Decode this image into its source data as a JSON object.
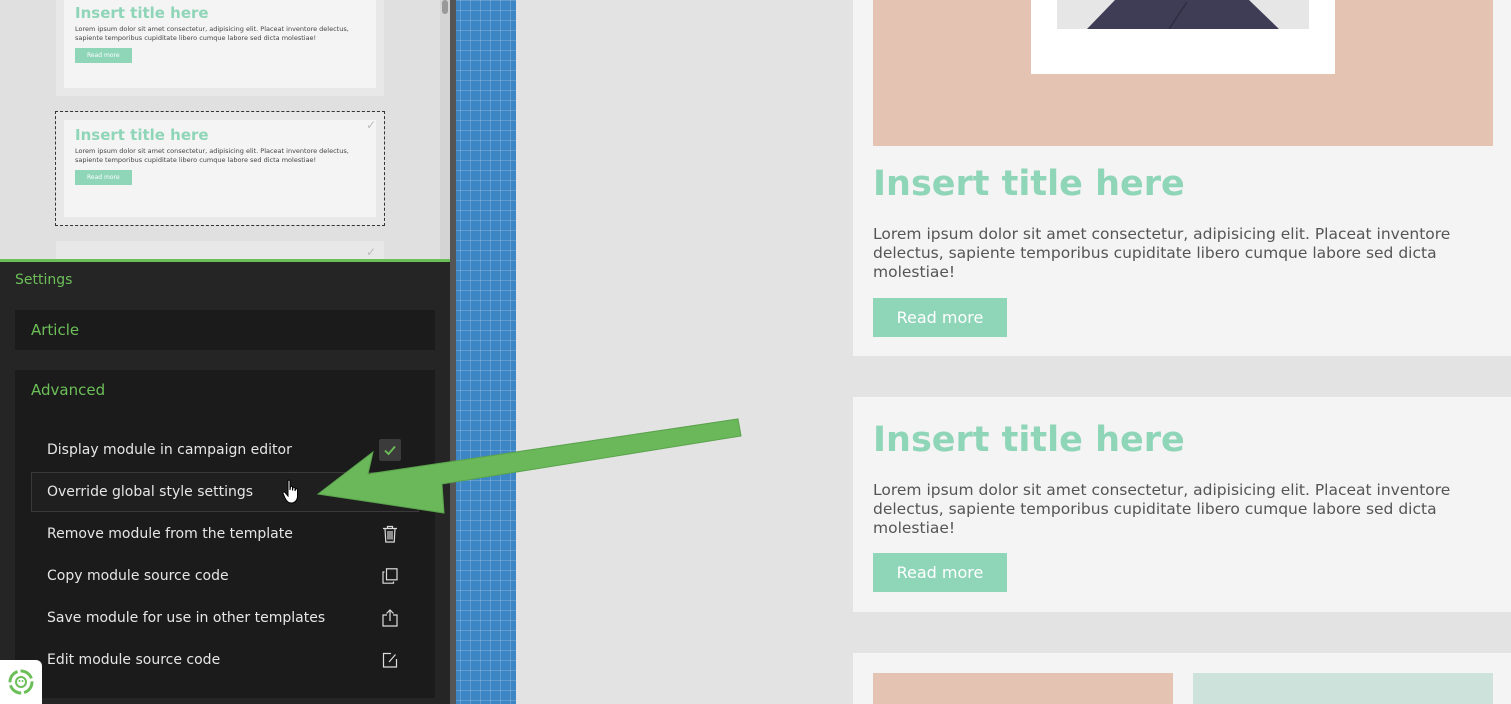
{
  "module_list": {
    "thumbnails": [
      {
        "title": "Insert title here",
        "body": "Lorem ipsum dolor sit amet consectetur, adipisicing elit. Placeat inventore delectus, sapiente temporibus cupiditate libero cumque labore sed dicta molestiae!",
        "button": "Read more"
      },
      {
        "title": "Insert title here",
        "body": "Lorem ipsum dolor sit amet consectetur, adipisicing elit. Placeat inventore delectus, sapiente temporibus cupiditate libero cumque labore sed dicta molestiae!",
        "button": "Read more"
      }
    ]
  },
  "settings": {
    "title": "Settings",
    "sections": {
      "article": "Article",
      "advanced": "Advanced"
    },
    "options": [
      {
        "label": "Display module in campaign editor",
        "icon": "checkbox-checked-icon"
      },
      {
        "label": "Override global style settings",
        "icon": "none"
      },
      {
        "label": "Remove module from the template",
        "icon": "trash-icon"
      },
      {
        "label": "Copy module source code",
        "icon": "copy-icon"
      },
      {
        "label": "Save module for use in other templates",
        "icon": "share-icon"
      },
      {
        "label": "Edit module source code",
        "icon": "edit-icon"
      }
    ]
  },
  "canvas": {
    "cards": [
      {
        "title": "Insert title here",
        "body": "Lorem ipsum dolor sit amet consectetur, adipisicing elit. Placeat inventore delectus, sapiente temporibus cupiditate libero cumque labore sed dicta molestiae!",
        "button": "Read more"
      },
      {
        "title": "Insert title here",
        "body": "Lorem ipsum dolor sit amet consectetur, adipisicing elit. Placeat inventore delectus, sapiente temporibus cupiditate libero cumque labore sed dicta molestiae!",
        "button": "Read more"
      }
    ]
  },
  "colors": {
    "accent_green": "#6cbf58",
    "mint": "#8fd5b8",
    "peach": "#e4c3b2",
    "panel_dark": "#252525",
    "grid_blue": "#3d86c6"
  }
}
